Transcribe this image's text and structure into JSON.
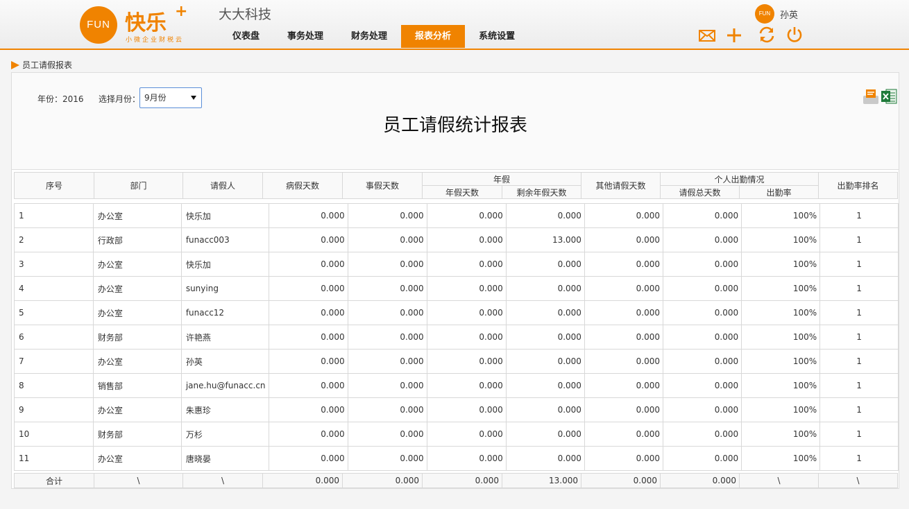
{
  "header": {
    "logo_circle_text": "FUN",
    "logo_text": "快乐",
    "logo_plus": "+",
    "logo_slogan": "小微企业财税云",
    "company_name": "大大科技",
    "user_avatar_text": "FUN",
    "user_name": "孙英",
    "nav": [
      {
        "label": "仪表盘",
        "active": false
      },
      {
        "label": "事务处理",
        "active": false
      },
      {
        "label": "财务处理",
        "active": false
      },
      {
        "label": "报表分析",
        "active": true
      },
      {
        "label": "系统设置",
        "active": false
      }
    ],
    "icons": [
      "mail-icon",
      "plus-icon",
      "refresh-icon",
      "power-icon"
    ],
    "accent_color": "#f08300"
  },
  "breadcrumb": "员工请假报表",
  "filters": {
    "year_label": "年份：2016",
    "month_label": "选择月份：",
    "month_value": "9月份"
  },
  "report_title": "员工请假统计报表",
  "table": {
    "headers": {
      "index": "序号",
      "dept": "部门",
      "person": "请假人",
      "sick": "病假天数",
      "personal": "事假天数",
      "annual_group": "年假",
      "annual_days": "年假天数",
      "annual_remaining": "剩余年假天数",
      "other": "其他请假天数",
      "attendance_group": "个人出勤情况",
      "total_leave": "请假总天数",
      "attendance_rate": "出勤率",
      "rank": "出勤率排名"
    },
    "rows": [
      [
        "1",
        "办公室",
        "快乐加",
        "0.000",
        "0.000",
        "0.000",
        "0.000",
        "0.000",
        "0.000",
        "100%",
        "1"
      ],
      [
        "2",
        "行政部",
        "funacc003",
        "0.000",
        "0.000",
        "0.000",
        "13.000",
        "0.000",
        "0.000",
        "100%",
        "1"
      ],
      [
        "3",
        "办公室",
        "快乐加",
        "0.000",
        "0.000",
        "0.000",
        "0.000",
        "0.000",
        "0.000",
        "100%",
        "1"
      ],
      [
        "4",
        "办公室",
        "sunying",
        "0.000",
        "0.000",
        "0.000",
        "0.000",
        "0.000",
        "0.000",
        "100%",
        "1"
      ],
      [
        "5",
        "办公室",
        "funacc12",
        "0.000",
        "0.000",
        "0.000",
        "0.000",
        "0.000",
        "0.000",
        "100%",
        "1"
      ],
      [
        "6",
        "财务部",
        "许艳燕",
        "0.000",
        "0.000",
        "0.000",
        "0.000",
        "0.000",
        "0.000",
        "100%",
        "1"
      ],
      [
        "7",
        "办公室",
        "孙英",
        "0.000",
        "0.000",
        "0.000",
        "0.000",
        "0.000",
        "0.000",
        "100%",
        "1"
      ],
      [
        "8",
        "销售部",
        "jane.hu@funacc.cn",
        "0.000",
        "0.000",
        "0.000",
        "0.000",
        "0.000",
        "0.000",
        "100%",
        "1"
      ],
      [
        "9",
        "办公室",
        "朱惠珍",
        "0.000",
        "0.000",
        "0.000",
        "0.000",
        "0.000",
        "0.000",
        "100%",
        "1"
      ],
      [
        "10",
        "财务部",
        "万杉",
        "0.000",
        "0.000",
        "0.000",
        "0.000",
        "0.000",
        "0.000",
        "100%",
        "1"
      ],
      [
        "11",
        "办公室",
        "唐晓晏",
        "0.000",
        "0.000",
        "0.000",
        "0.000",
        "0.000",
        "0.000",
        "100%",
        "1"
      ]
    ],
    "footer": [
      "合计",
      "\\",
      "\\",
      "0.000",
      "0.000",
      "0.000",
      "13.000",
      "0.000",
      "0.000",
      "\\",
      "\\"
    ]
  }
}
